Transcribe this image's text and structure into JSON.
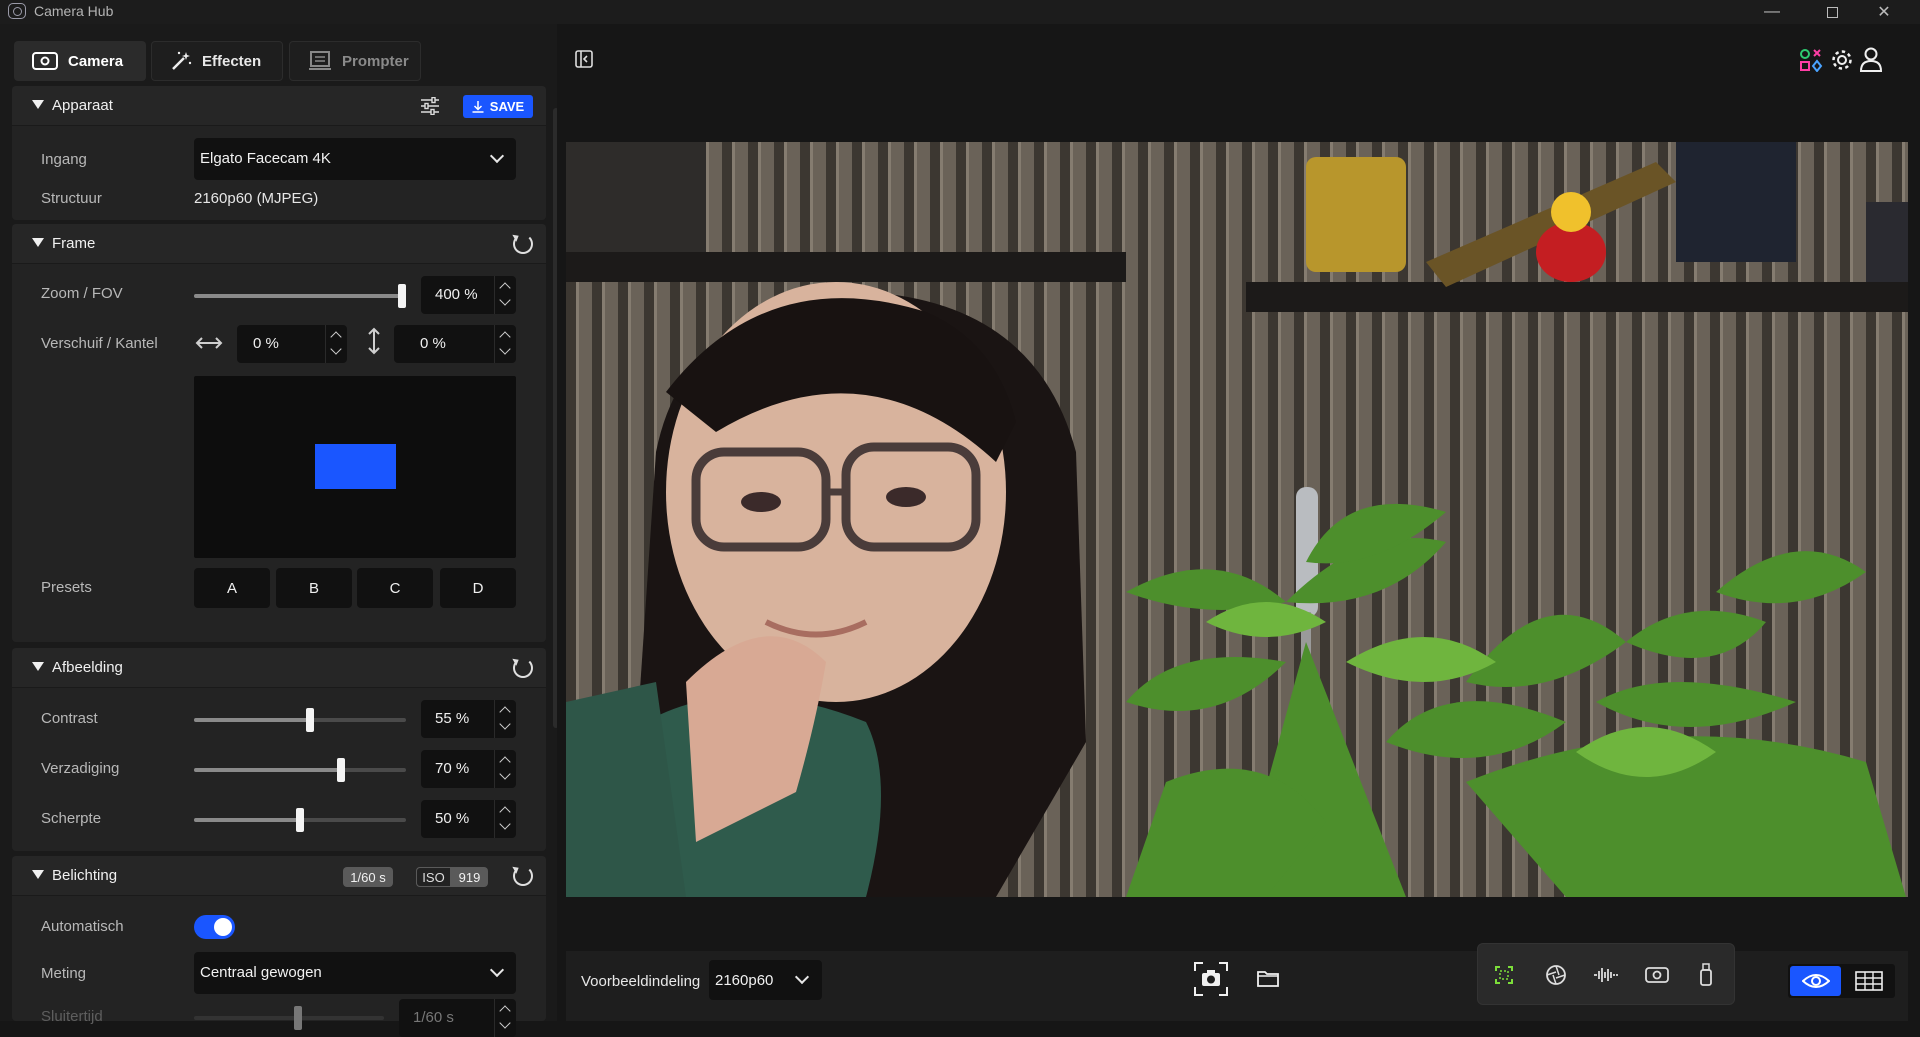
{
  "window": {
    "title": "Camera Hub"
  },
  "tabs": [
    {
      "label": "Camera",
      "icon": "camera-icon",
      "state": "active"
    },
    {
      "label": "Effecten",
      "icon": "magic-wand-icon",
      "state": "inactive"
    },
    {
      "label": "Prompter",
      "icon": "prompter-icon",
      "state": "disabled"
    }
  ],
  "device": {
    "title": "Apparaat",
    "save_label": "SAVE",
    "input_label": "Ingang",
    "input_value": "Elgato Facecam 4K",
    "format_label": "Structuur",
    "format_value": "2160p60 (MJPEG)"
  },
  "frame": {
    "title": "Frame",
    "zoom_label": "Zoom / FOV",
    "zoom_value": "400 %",
    "zoom_level": 1.0,
    "pantilt_label": "Verschuif / Kantel",
    "pan_value": "0 %",
    "tilt_value": "0 %",
    "presets_label": "Presets",
    "presets": [
      "A",
      "B",
      "C",
      "D"
    ]
  },
  "image": {
    "title": "Afbeelding",
    "rows": [
      {
        "label": "Contrast",
        "value": "55 %",
        "level": 0.55
      },
      {
        "label": "Verzadiging",
        "value": "70 %",
        "level": 0.7
      },
      {
        "label": "Scherpte",
        "value": "50 %",
        "level": 0.5
      }
    ]
  },
  "exposure": {
    "title": "Belichting",
    "shutter_badge": "1/60 s",
    "iso_label": "ISO",
    "iso_value": "919",
    "auto_label": "Automatisch",
    "auto_on": true,
    "metering_label": "Meting",
    "metering_value": "Centraal gewogen",
    "shutter_label": "Sluitertijd",
    "shutter_value": "1/60 s",
    "shutter_level": 0.5
  },
  "bottom": {
    "preview_label": "Voorbeeldindeling",
    "preview_value": "2160p60"
  },
  "colors": {
    "accent": "#1a56ff",
    "panel": "#232323",
    "background": "#161616"
  }
}
